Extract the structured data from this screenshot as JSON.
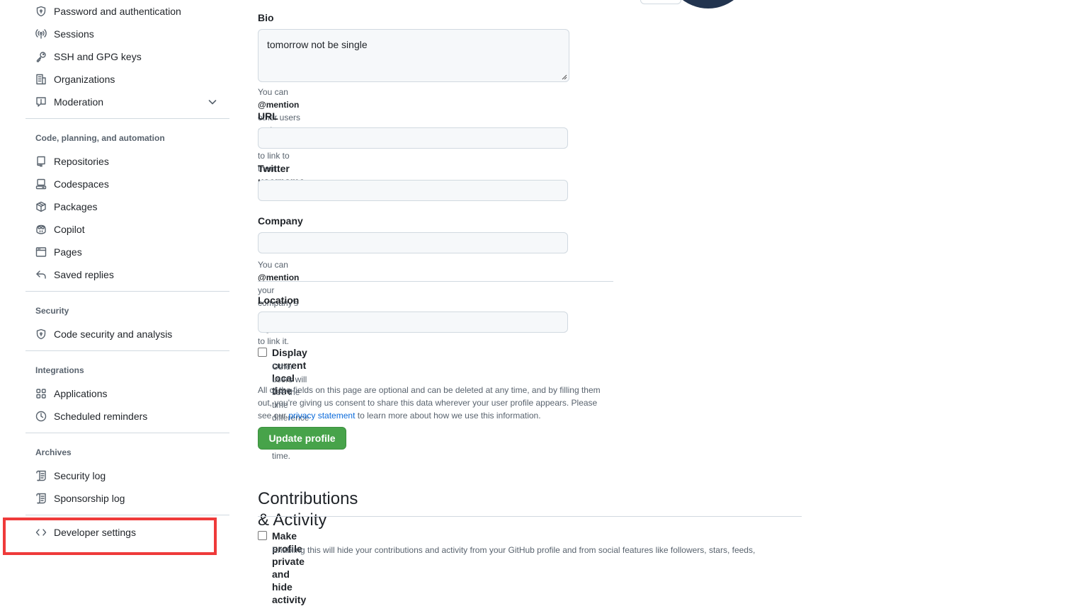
{
  "sidebar": {
    "items_top": [
      {
        "label": "Password and authentication",
        "icon": "shield-icon"
      },
      {
        "label": "Sessions",
        "icon": "broadcast-icon"
      },
      {
        "label": "SSH and GPG keys",
        "icon": "key-icon"
      },
      {
        "label": "Organizations",
        "icon": "organization-icon"
      },
      {
        "label": "Moderation",
        "icon": "report-icon"
      }
    ],
    "groups": [
      {
        "title": "Code, planning, and automation",
        "items": [
          {
            "label": "Repositories",
            "icon": "repo-icon"
          },
          {
            "label": "Codespaces",
            "icon": "codespaces-icon"
          },
          {
            "label": "Packages",
            "icon": "package-icon"
          },
          {
            "label": "Copilot",
            "icon": "copilot-icon"
          },
          {
            "label": "Pages",
            "icon": "browser-icon"
          },
          {
            "label": "Saved replies",
            "icon": "reply-icon"
          }
        ]
      },
      {
        "title": "Security",
        "items": [
          {
            "label": "Code security and analysis",
            "icon": "shield-lock-icon"
          }
        ]
      },
      {
        "title": "Integrations",
        "items": [
          {
            "label": "Applications",
            "icon": "apps-icon"
          },
          {
            "label": "Scheduled reminders",
            "icon": "clock-icon"
          }
        ]
      },
      {
        "title": "Archives",
        "items": [
          {
            "label": "Security log",
            "icon": "log-icon"
          },
          {
            "label": "Sponsorship log",
            "icon": "log-icon"
          }
        ]
      }
    ],
    "developer_settings": {
      "label": "Developer settings",
      "icon": "code-icon"
    }
  },
  "form": {
    "bio": {
      "label": "Bio",
      "value": "tomorrow not be single"
    },
    "bio_note_prefix": "You can ",
    "bio_note_mention": "@mention",
    "bio_note_suffix": " other users and organizations to link to them.",
    "url": {
      "label": "URL",
      "value": ""
    },
    "twitter": {
      "label": "Twitter username",
      "value": ""
    },
    "company": {
      "label": "Company",
      "value": ""
    },
    "company_note_prefix": "You can ",
    "company_note_mention": "@mention",
    "company_note_suffix": " your company's GitHub organization to link it.",
    "location": {
      "label": "Location",
      "value": ""
    },
    "local_time": {
      "label": "Display current local time",
      "note": "Other users will see the time difference from their local time.",
      "checked": false
    },
    "consent_text_1": "All of the fields on this page are optional and can be deleted at any time, and by filling them out, you're giving us consent to share this data wherever your user profile appears. Please see our ",
    "consent_link": "privacy statement",
    "consent_text_2": " to learn more about how we use this information.",
    "update_button": "Update profile"
  },
  "contributions": {
    "heading": "Contributions & Activity",
    "private": {
      "label": "Make profile private and hide activity",
      "note": "Enabling this will hide your contributions and activity from your GitHub profile and from social features like followers, stars, feeds,",
      "checked": false
    }
  },
  "colors": {
    "accent_green": "#47a34a",
    "link_blue": "#0969da",
    "highlight_red": "#ef3a3a"
  }
}
